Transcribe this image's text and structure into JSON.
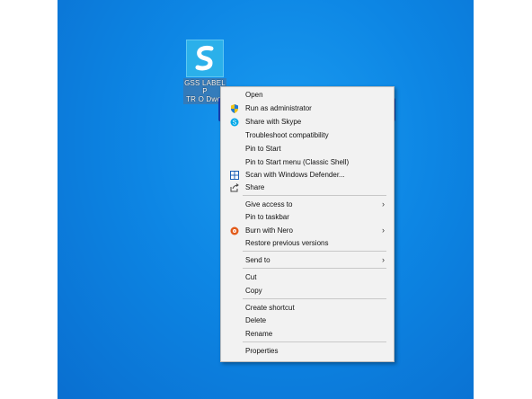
{
  "desktop": {
    "icon_label": "GSS LABEL P\nTR O Dwer"
  },
  "menu": {
    "items": [
      {
        "label": "Open"
      },
      {
        "label": "Run as administrator",
        "icon": "shield-icon"
      },
      {
        "label": "Share with Skype",
        "icon": "skype-icon"
      },
      {
        "label": "Troubleshoot compatibility"
      },
      {
        "label": "Pin to Start"
      },
      {
        "label": "Pin to Start menu (Classic Shell)"
      },
      {
        "label": "Scan with Windows Defender...",
        "icon": "defender-icon"
      },
      {
        "label": "Share",
        "icon": "share-icon"
      },
      {
        "label": "Give access to",
        "submenu": true
      },
      {
        "label": "Pin to taskbar"
      },
      {
        "label": "Burn with Nero",
        "icon": "nero-icon",
        "submenu": true
      },
      {
        "label": "Restore previous versions"
      },
      {
        "label": "Send to",
        "submenu": true
      },
      {
        "label": "Cut"
      },
      {
        "label": "Copy"
      },
      {
        "label": "Create shortcut"
      },
      {
        "label": "Delete"
      },
      {
        "label": "Rename"
      },
      {
        "label": "Properties"
      }
    ],
    "submenu_arrow": "›"
  },
  "colors": {
    "desktop_blue": "#0d86e4",
    "highlight_border": "#1a3fb0"
  }
}
